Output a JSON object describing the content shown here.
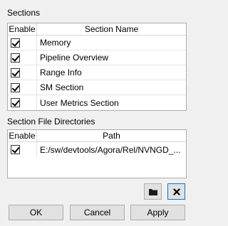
{
  "sections": {
    "label": "Sections",
    "columns": {
      "enable": "Enable",
      "name": "Section Name"
    },
    "rows": [
      {
        "name": "Memory",
        "enabled": true
      },
      {
        "name": "Pipeline Overview",
        "enabled": true
      },
      {
        "name": "Range Info",
        "enabled": true
      },
      {
        "name": "SM Section",
        "enabled": true
      },
      {
        "name": "User Metrics Section",
        "enabled": true
      }
    ]
  },
  "directories": {
    "label": "Section File Directories",
    "columns": {
      "enable": "Enable",
      "path": "Path"
    },
    "rows": [
      {
        "path": "E:/sw/devtools/Agora/Rel/NVNGD_...",
        "enabled": true
      }
    ]
  },
  "icons": {
    "browse": "folder-icon",
    "remove": "close-icon"
  },
  "buttons": {
    "ok": "OK",
    "cancel": "Cancel",
    "apply": "Apply"
  },
  "colors": {
    "focus_border": "#0078d7",
    "button_bg": "#e1e1e1",
    "window_bg": "#f0f0f0"
  }
}
